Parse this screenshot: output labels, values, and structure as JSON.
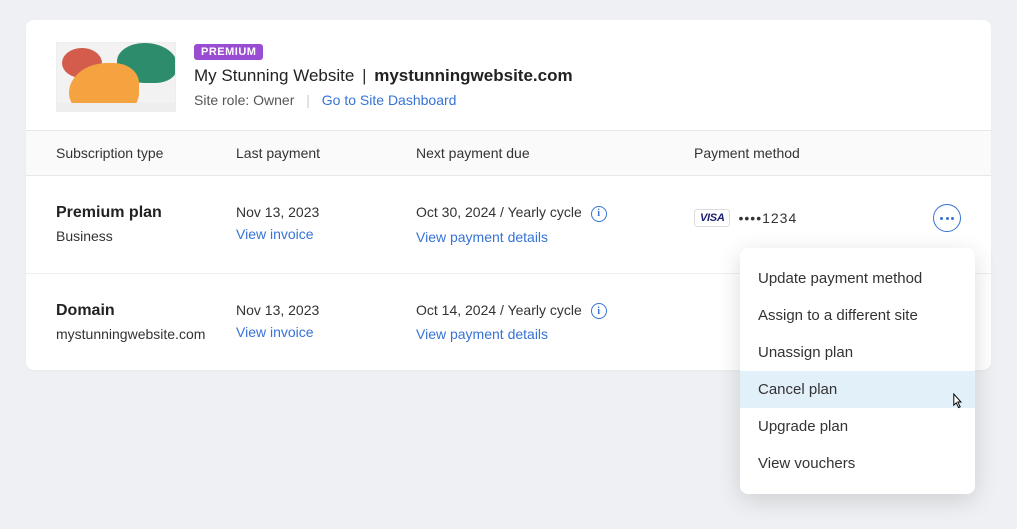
{
  "site": {
    "badge": "PREMIUM",
    "name": "My Stunning Website",
    "domain": "mystunningwebsite.com",
    "role_label": "Site role: Owner",
    "dashboard_link": "Go to Site Dashboard"
  },
  "columns": {
    "subscription": "Subscription type",
    "last_payment": "Last payment",
    "next_payment": "Next payment due",
    "payment_method": "Payment method"
  },
  "rows": [
    {
      "title": "Premium plan",
      "subtitle": "Business",
      "last_date": "Nov 13, 2023",
      "view_invoice": "View invoice",
      "next_text": "Oct 30, 2024 / Yearly cycle",
      "view_details": "View payment details",
      "card_brand": "VISA",
      "card_mask": "••••1234"
    },
    {
      "title": "Domain",
      "subtitle": "mystunningwebsite.com",
      "last_date": "Nov 13, 2023",
      "view_invoice": "View invoice",
      "next_text": "Oct 14, 2024 / Yearly cycle",
      "view_details": "View payment details"
    }
  ],
  "menu": {
    "items": [
      "Update payment method",
      "Assign to a different site",
      "Unassign plan",
      "Cancel plan",
      "Upgrade plan",
      "View vouchers"
    ],
    "hover_index": 3
  }
}
